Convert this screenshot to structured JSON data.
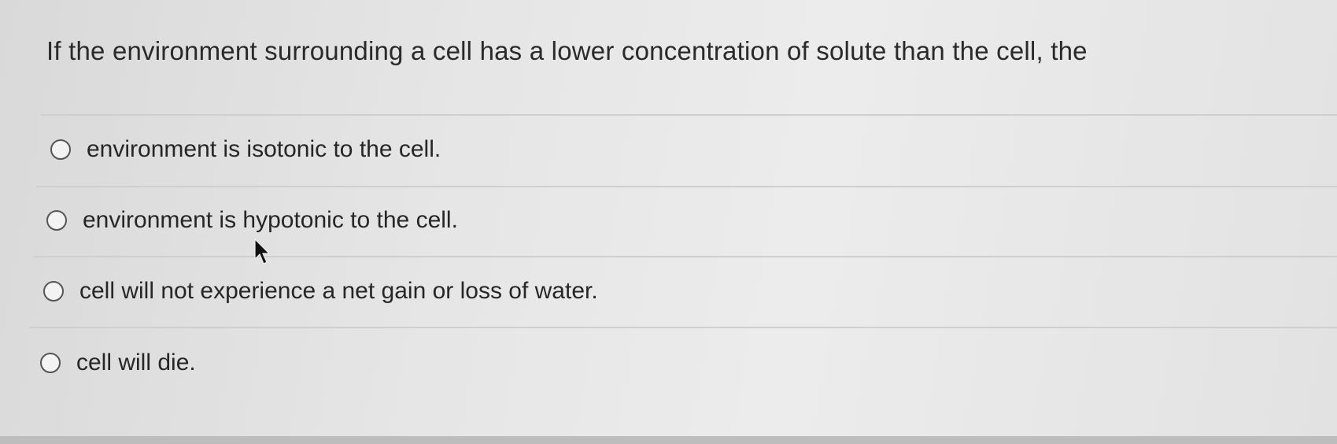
{
  "question": {
    "text": "If the environment surrounding a cell has a lower concentration of solute than the cell, the"
  },
  "options": [
    {
      "label": "environment is isotonic to the cell.",
      "selected": false
    },
    {
      "label": "environment is hypotonic to the cell.",
      "selected": false
    },
    {
      "label": "cell will not experience a net gain or loss of water.",
      "selected": false
    },
    {
      "label": "cell will die.",
      "selected": false
    }
  ],
  "icons": {
    "radio": "radio-unchecked-icon",
    "cursor": "mouse-pointer-icon"
  }
}
